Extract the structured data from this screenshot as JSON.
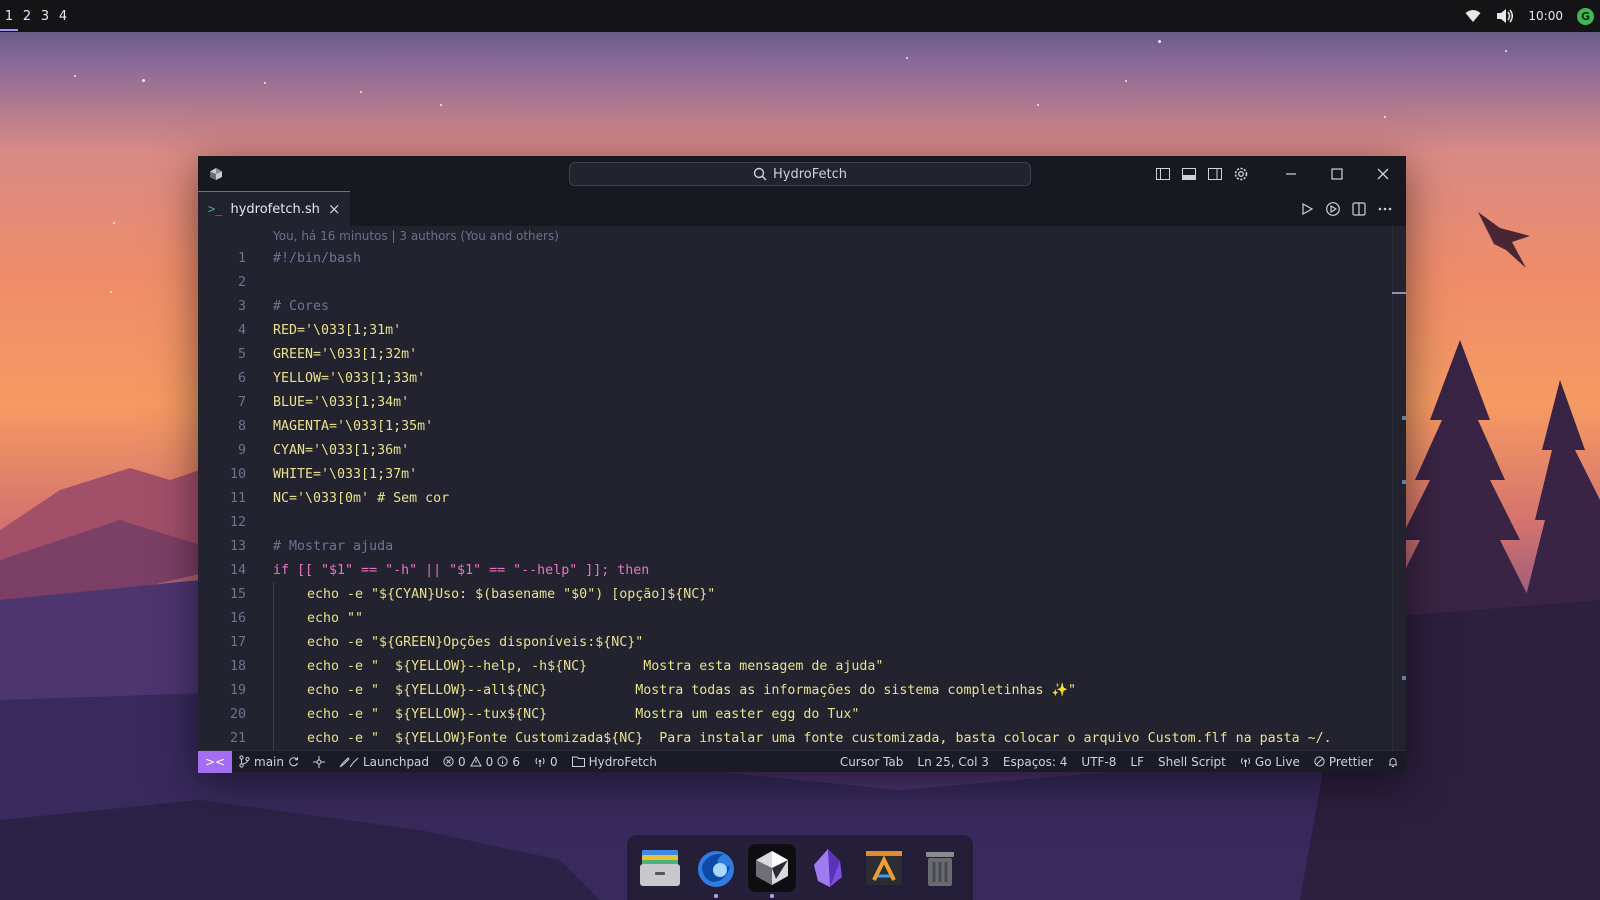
{
  "panel": {
    "workspaces": [
      "1",
      "2",
      "3",
      "4"
    ],
    "active_workspace": "1",
    "clock": "10:00",
    "tray_icons": [
      "wifi-icon",
      "volume-icon",
      "user-avatar"
    ],
    "avatar_letter": "G"
  },
  "window": {
    "command_center_label": "HydroFetch",
    "title_icons": [
      "toggle-primary-sidebar-icon",
      "toggle-panel-icon",
      "toggle-secondary-sidebar-icon",
      "gear-icon"
    ],
    "controls": [
      "minimize-icon",
      "maximize-icon",
      "close-icon"
    ]
  },
  "tab": {
    "label": "hydrofetch.sh",
    "icon": ">_",
    "close": "×",
    "actions": [
      "run-icon",
      "debug-icon",
      "split-editor-icon",
      "more-icon"
    ]
  },
  "editor": {
    "blame": "You, há 16 minutos | 3 authors (You and others)",
    "line_numbers": [
      "1",
      "2",
      "3",
      "4",
      "5",
      "6",
      "7",
      "8",
      "9",
      "10",
      "11",
      "12",
      "13",
      "14",
      "15",
      "16",
      "17",
      "18",
      "19",
      "20",
      "21"
    ],
    "lines": [
      "#!/bin/bash",
      "",
      "# Cores",
      "RED='\\033[1;31m'",
      "GREEN='\\033[1;32m'",
      "YELLOW='\\033[1;33m'",
      "BLUE='\\033[1;34m'",
      "MAGENTA='\\033[1;35m'",
      "CYAN='\\033[1;36m'",
      "WHITE='\\033[1;37m'",
      "NC='\\033[0m' # Sem cor",
      "",
      "# Mostrar ajuda",
      "if [[ \"$1\" == \"-h\" || \"$1\" == \"--help\" ]]; then",
      "echo -e \"${CYAN}Uso: $(basename \"$0\") [opção]${NC}\"",
      "echo \"\"",
      "echo -e \"${GREEN}Opções disponíveis:${NC}\"",
      "echo -e \"  ${YELLOW}--help, -h${NC}       Mostra esta mensagem de ajuda\"",
      "echo -e \"  ${YELLOW}--all${NC}           Mostra todas as informações do sistema completinhas ✨\"",
      "echo -e \"  ${YELLOW}--tux${NC}           Mostra um easter egg do Tux\"",
      "echo -e \"  ${YELLOW}Fonte Customizada${NC}  Para instalar uma fonte customizada, basta colocar o arquivo Custom.flf na pasta ~/."
    ]
  },
  "statusbar": {
    "remote": "><",
    "branch": "main",
    "launchpad": "Launchpad",
    "errors": "0",
    "warnings": "0",
    "infos": "6",
    "ports": "0",
    "folder": "HydroFetch",
    "cursor_tab": "Cursor Tab",
    "position": "Ln 25, Col 3",
    "spaces": "Espaços: 4",
    "encoding": "UTF-8",
    "eol": "LF",
    "language": "Shell Script",
    "golive": "Go Live",
    "prettier": "Prettier"
  },
  "dock": {
    "apps": [
      "files-app-icon",
      "thunderbird-app-icon",
      "cursor-app-icon",
      "obsidian-app-icon",
      "sublime-app-icon",
      "trash-icon"
    ]
  },
  "colors": {
    "accent": "#a46ef2",
    "editor_bg": "#22232e",
    "panel_bg": "#141417"
  }
}
